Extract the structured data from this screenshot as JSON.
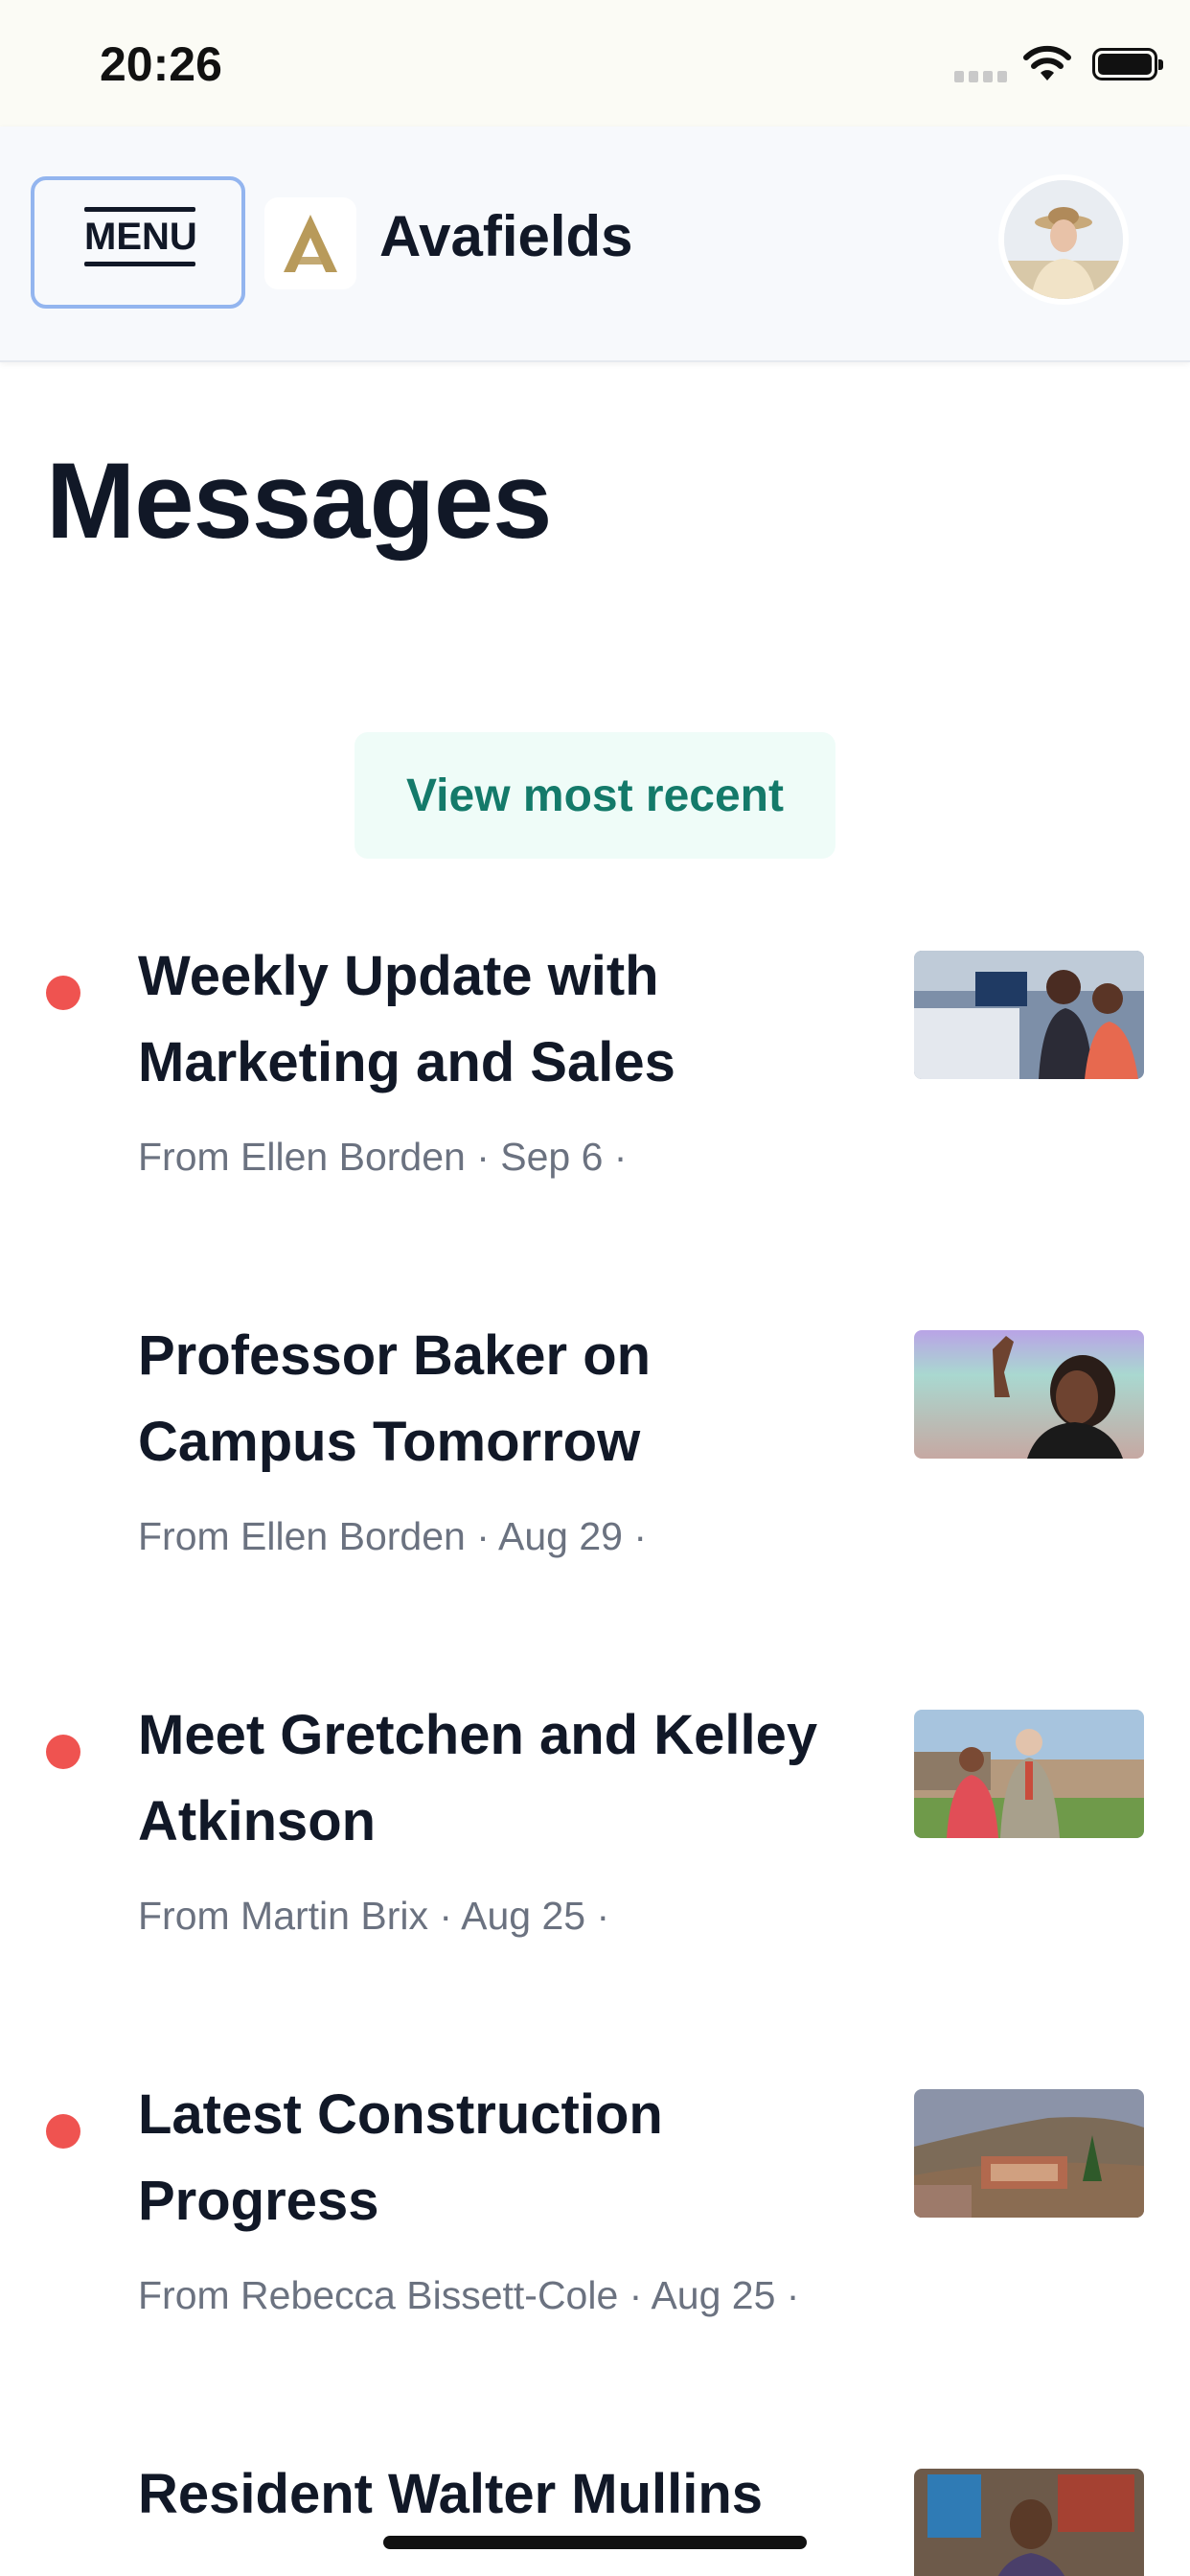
{
  "status_bar": {
    "time": "20:26"
  },
  "header": {
    "menu_label": "MENU",
    "app_name": "Avafields",
    "brand_color": "#b89a5a"
  },
  "page": {
    "title": "Messages",
    "recent_button_label": "View most recent"
  },
  "messages": [
    {
      "title_line1": "Weekly Update with",
      "title_line2": "Marketing and Sales",
      "meta": "From Ellen Borden · Sep 6 ·",
      "unread": true,
      "thumb": "office-meeting-photo"
    },
    {
      "title_line1": "Professor Baker on",
      "title_line2": "Campus Tomorrow",
      "meta": "From Ellen Borden · Aug 29 ·",
      "unread": false,
      "thumb": "speaker-photo"
    },
    {
      "title_line1": "Meet Gretchen and Kelley",
      "title_line2": "Atkinson",
      "meta": "From Martin Brix · Aug 25 ·",
      "unread": true,
      "thumb": "couple-photo"
    },
    {
      "title_line1": "Latest Construction",
      "title_line2": "Progress",
      "meta": "From Rebecca Bissett-Cole · Aug 25 ·",
      "unread": true,
      "thumb": "construction-site-photo"
    },
    {
      "title_line1": "Resident Walter Mullins",
      "unread": false,
      "thumb": "resident-portrait-photo"
    }
  ],
  "colors": {
    "unread_dot": "#ef5350",
    "recent_button_bg": "#effcf8",
    "recent_button_text": "#147a6a",
    "menu_border": "#93b5ef"
  }
}
